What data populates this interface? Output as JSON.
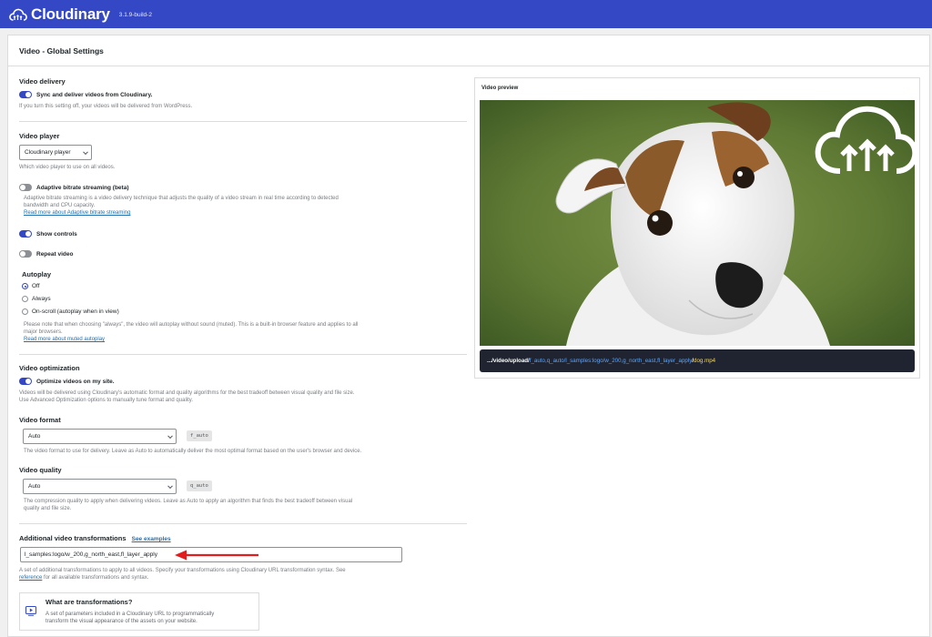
{
  "header": {
    "brand": "Cloudinary",
    "version": "3.1.9-build-2",
    "accent": "#3448c5"
  },
  "page": {
    "title": "Video - Global Settings"
  },
  "delivery": {
    "title": "Video delivery",
    "toggle_label": "Sync and deliver videos from Cloudinary.",
    "toggle_on": true,
    "help": "If you turn this setting off, your videos will be delivered from WordPress."
  },
  "player": {
    "title": "Video player",
    "selected": "Cloudinary player",
    "help": "Which video player to use on all videos.",
    "abr_label": "Adaptive bitrate streaming (beta)",
    "abr_on": false,
    "abr_help_1": "Adaptive bitrate streaming is a video delivery technique that adjusts the quality of a video stream in real time according to detected",
    "abr_help_2": "bandwidth and CPU capacity.",
    "abr_link": "Read more about Adaptive bitrate streaming",
    "controls_label": "Show controls",
    "controls_on": true,
    "repeat_label": "Repeat video",
    "repeat_on": false
  },
  "autoplay": {
    "title": "Autoplay",
    "options": [
      "Off",
      "Always",
      "On-scroll (autoplay when in view)"
    ],
    "selected": "Off",
    "help_1": "Please note that when choosing \"always\", the video will autoplay without sound (muted). This is a built-in browser feature and applies to all",
    "help_2": "major browsers.",
    "link": "Read more about muted autoplay"
  },
  "optimization": {
    "title": "Video optimization",
    "toggle_label": "Optimize videos on my site.",
    "toggle_on": true,
    "help_1": "Videos will be delivered using Cloudinary's automatic format and quality algorithms for the best tradeoff between visual quality and file size.",
    "help_2": "Use Advanced Optimization options to manually tune format and quality."
  },
  "format": {
    "title": "Video format",
    "selected": "Auto",
    "code": "f_auto",
    "help": "The video format to use for delivery. Leave as Auto to automatically deliver the most optimal format based on the user's browser and device."
  },
  "quality": {
    "title": "Video quality",
    "selected": "Auto",
    "code": "q_auto",
    "help_1": "The compression quality to apply when delivering videos. Leave as Auto to apply an algorithm that finds the best tradeoff between visual",
    "help_2": "quality and file size."
  },
  "transformations": {
    "title": "Additional video transformations",
    "examples_link": "See examples",
    "value": "l_samples:logo/w_200,g_north_east,fl_layer_apply",
    "help_1": "A set of additional transformations to apply to all videos. Specify your transformations using Cloudinary URL transformation syntax. See",
    "help_link": "reference",
    "help_2": " for all available transformations and syntax.",
    "card_title": "What are transformations?",
    "card_text_1": "A set of parameters included in a Cloudinary URL to programmatically",
    "card_text_2": "transform the visual appearance of the assets on your website."
  },
  "preview": {
    "title": "Video preview",
    "url_base": ".../video/upload/",
    "url_transform": "f_auto,q_auto/l_samples:logo/w_200,g_north_east,fl_layer_apply",
    "url_sep": "/",
    "url_file": "dog.mp4"
  },
  "icons": [
    "cloudinary-logo-icon",
    "chevron-down-icon",
    "video-icon",
    "red-arrow-icon",
    "cloud-upload-icon"
  ]
}
